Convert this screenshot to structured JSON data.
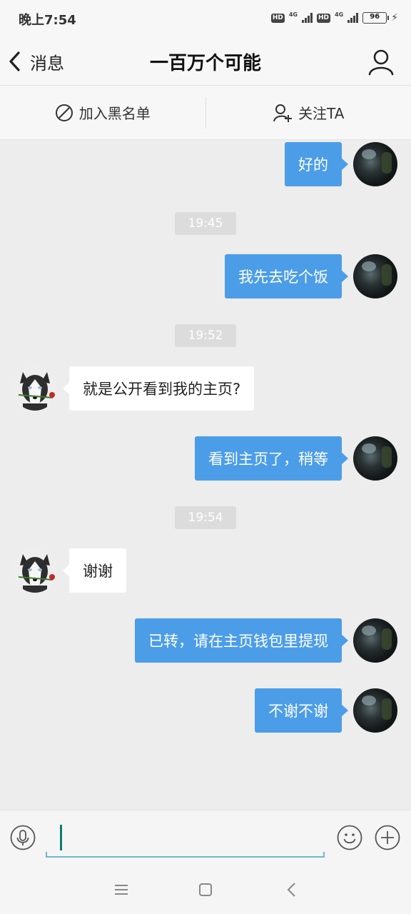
{
  "status_bar": {
    "time": "晚上7:54",
    "hd1": "HD",
    "net1": "4G",
    "hd2": "HD",
    "net2": "4G",
    "battery": "96",
    "battery_color": "#4cd23b"
  },
  "header": {
    "back_label": "消息",
    "title": "一百万个可能",
    "back_icon": "chevron-left-icon",
    "profile_icon": "user-icon"
  },
  "actions": {
    "blacklist_label": "加入黑名单",
    "follow_label": "关注TA"
  },
  "chat": {
    "accent": "#4c9de8",
    "messages": [
      {
        "side": "me",
        "text": "好的"
      },
      {
        "time": "19:45"
      },
      {
        "side": "me",
        "text": "我先去吃个饭"
      },
      {
        "time": "19:52"
      },
      {
        "side": "other",
        "text": "就是公开看到我的主页?"
      },
      {
        "side": "me",
        "text": "看到主页了，稍等"
      },
      {
        "time": "19:54"
      },
      {
        "side": "other",
        "text": "谢谢"
      },
      {
        "side": "me",
        "text": "已转，请在主页钱包里提现"
      },
      {
        "side": "me",
        "text": "不谢不谢"
      }
    ]
  },
  "input": {
    "value": "",
    "mic_icon": "mic-icon",
    "emoji_icon": "emoji-icon",
    "plus_icon": "plus-icon"
  },
  "nav": {
    "menu_icon": "menu-icon",
    "home_icon": "home-icon",
    "back_icon": "back-icon"
  }
}
